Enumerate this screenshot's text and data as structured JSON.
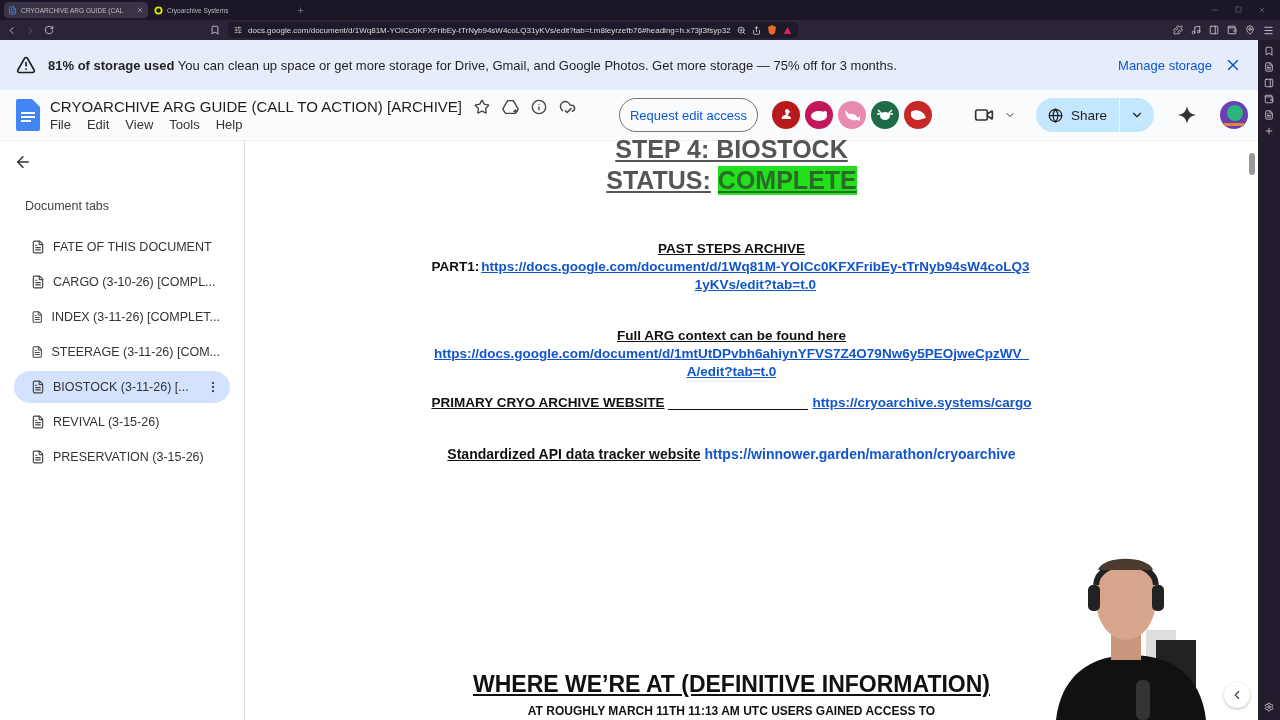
{
  "browser": {
    "tabs": [
      {
        "title": "CRYOARCHIVE ARG GUIDE (CAL",
        "selected": true,
        "kind": "docs"
      },
      {
        "title": "Cryoarchive Systems",
        "selected": false,
        "kind": "site"
      }
    ],
    "url": "docs.google.com/document/d/1Wq81M-YOICc0KFXFribEy-tTrNyb94sW4coLQ31yKVs/edit?tab=t.m8leyrzefb76#heading=h.x73jl3fsyp32"
  },
  "banner": {
    "message": "**81% of storage used** You can clean up space or get more storage for Drive, Gmail, and Google Photos. Get more storage — 75% off for 3 months.",
    "action": "Manage storage"
  },
  "doc": {
    "title": "CRYOARCHIVE ARG GUIDE (CALL TO ACTION) [ARCHIVE]",
    "menu": [
      "File",
      "Edit",
      "View",
      "Tools",
      "Help"
    ],
    "request_button": "Request edit access",
    "collaborators": [
      {
        "color": "#b7191c",
        "kind": "bird"
      },
      {
        "color": "#c2185b",
        "kind": "wombat"
      },
      {
        "color": "#e88bb0",
        "kind": "whale"
      },
      {
        "color": "#1e6b4a",
        "kind": "axolotl"
      },
      {
        "color": "#c62828",
        "kind": "seal"
      }
    ],
    "share_button": "Share"
  },
  "tabs_panel": {
    "heading": "Document tabs",
    "items": [
      {
        "label": "FATE OF THIS DOCUMENT",
        "selected": false
      },
      {
        "label": "CARGO (3-10-26) [COMPL...",
        "selected": false
      },
      {
        "label": "INDEX (3-11-26) [COMPLET...",
        "selected": false
      },
      {
        "label": "STEERAGE (3-11-26) [COM...",
        "selected": false
      },
      {
        "label": "BIOSTOCK (3-11-26) [...",
        "selected": true
      },
      {
        "label": "REVIVAL (3-15-26)",
        "selected": false
      },
      {
        "label": "PRESERVATION (3-15-26)",
        "selected": false
      }
    ]
  },
  "content": {
    "step_title": "STEP 4: BIOSTOCK",
    "status_label": "STATUS:",
    "status_value": "COMPLETE",
    "past_heading": "PAST STEPS ARCHIVE",
    "part_label": "PART1:",
    "part_link": "https://docs.google.com/document/d/1Wq81M-YOICc0KFXFribEy-tTrNyb94sW4coLQ31yKVs/edit?tab=t.0",
    "context_heading": "Full ARG context can be found here",
    "context_link": "https://docs.google.com/document/d/1mtUtDPvbh6ahiynYFVS7Z4O79Nw6y5PEOjweCpzWV_A/edit?tab=t.0",
    "website_label": "PRIMARY CRYO ARCHIVE WEBSITE",
    "website_link": "https://cryoarchive.systems/cargo",
    "tracker_label": "Standardized API data tracker website",
    "tracker_link": "https://winnower.garden/marathon/cryoarchive",
    "section_heading": "WHERE WE’RE AT (DEFINITIVE INFORMATION)",
    "section_text": "AT ROUGHLY MARCH 11TH 11:13 AM UTC USERS GAINED ACCESS TO"
  }
}
